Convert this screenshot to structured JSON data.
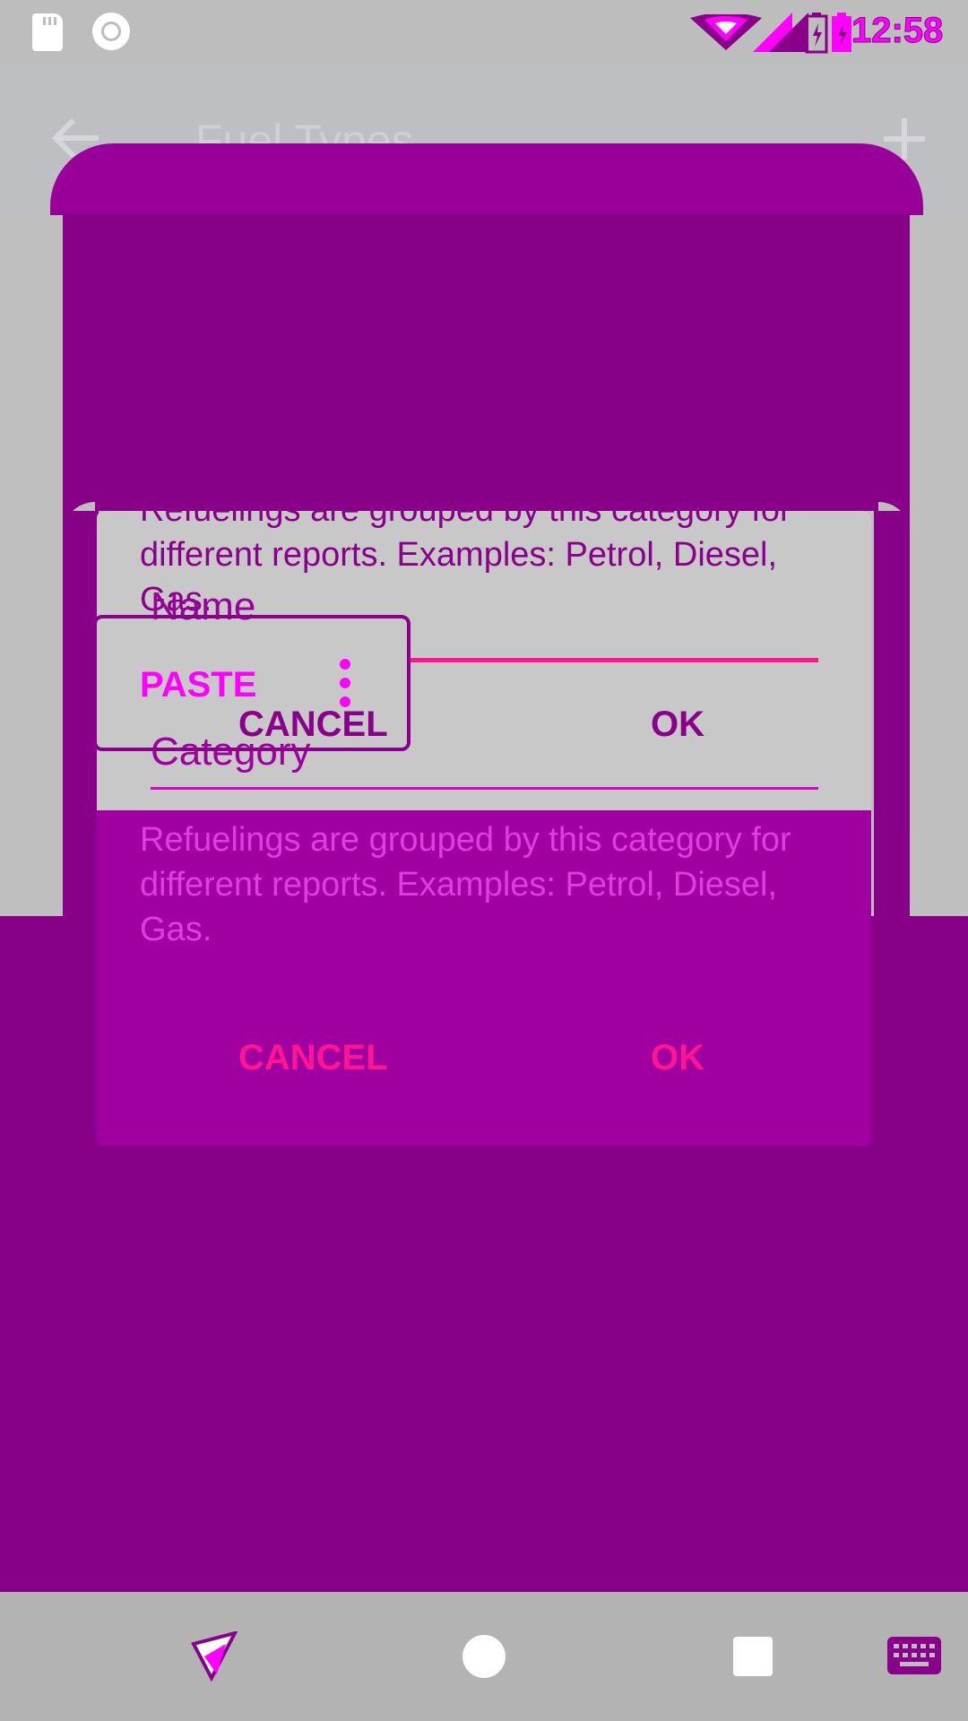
{
  "status_bar": {
    "time": "12:58",
    "icons": [
      "sd-card-icon",
      "ring-icon",
      "wifi-icon",
      "signal-icon",
      "battery-icon"
    ]
  },
  "app_bar": {
    "title": "Fuel Types",
    "back_icon": "arrow-left-icon",
    "add_icon": "plus-icon"
  },
  "dialog": {
    "name_label": "Name",
    "category_label": "Category",
    "description": "Refuelings are grouped by this category for different reports. Examples: Petrol, Diesel, Gas.",
    "cancel_label": "CANCEL",
    "ok_label": "OK"
  },
  "context_menu": {
    "paste_label": "PASTE",
    "more_icon": "more-vert-icon"
  },
  "nav_bar": {
    "icons": [
      "back-icon",
      "home-icon",
      "recents-icon",
      "keyboard-icon"
    ]
  },
  "colors": {
    "accent": "#ff1493",
    "magenta": "#ff00ff",
    "purple": "#880088",
    "dialog": "#a100a1",
    "status_bar": "#bdbdbd",
    "nav_bar": "#b3b3b3"
  }
}
